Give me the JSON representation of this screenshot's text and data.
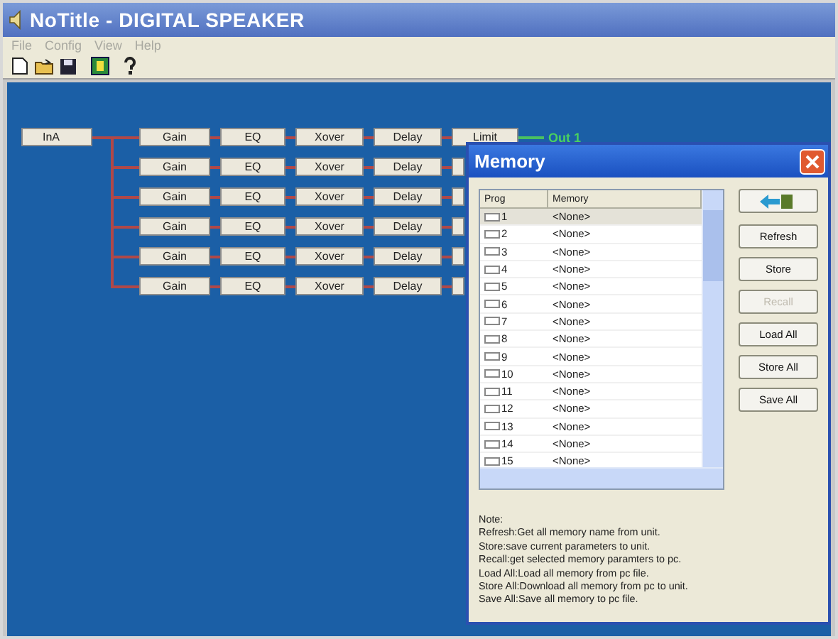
{
  "window": {
    "title": "NoTitle - DIGITAL SPEAKER"
  },
  "menu": [
    "File",
    "Config",
    "View",
    "Help"
  ],
  "chain": {
    "input": "InA",
    "rows": [
      {
        "blocks": [
          "Gain",
          "EQ",
          "Xover",
          "Delay",
          "Limit"
        ],
        "output": "Out 1"
      },
      {
        "blocks": [
          "Gain",
          "EQ",
          "Xover",
          "Delay"
        ]
      },
      {
        "blocks": [
          "Gain",
          "EQ",
          "Xover",
          "Delay"
        ]
      },
      {
        "blocks": [
          "Gain",
          "EQ",
          "Xover",
          "Delay"
        ]
      },
      {
        "blocks": [
          "Gain",
          "EQ",
          "Xover",
          "Delay"
        ]
      },
      {
        "blocks": [
          "Gain",
          "EQ",
          "Xover",
          "Delay"
        ]
      }
    ]
  },
  "dialog": {
    "title": "Memory",
    "columns": [
      "Prog",
      "Memory"
    ],
    "rows": [
      {
        "prog": "1",
        "memory": "<None>",
        "selected": true
      },
      {
        "prog": "2",
        "memory": "<None>",
        "selected": false
      },
      {
        "prog": "3",
        "memory": "<None>",
        "selected": false
      },
      {
        "prog": "4",
        "memory": "<None>",
        "selected": false
      },
      {
        "prog": "5",
        "memory": "<None>",
        "selected": false
      },
      {
        "prog": "6",
        "memory": "<None>",
        "selected": false
      },
      {
        "prog": "7",
        "memory": "<None>",
        "selected": false
      },
      {
        "prog": "8",
        "memory": "<None>",
        "selected": false
      },
      {
        "prog": "9",
        "memory": "<None>",
        "selected": false
      },
      {
        "prog": "10",
        "memory": "<None>",
        "selected": false
      },
      {
        "prog": "11",
        "memory": "<None>",
        "selected": false
      },
      {
        "prog": "12",
        "memory": "<None>",
        "selected": false
      },
      {
        "prog": "13",
        "memory": "<None>",
        "selected": false
      },
      {
        "prog": "14",
        "memory": "<None>",
        "selected": false
      },
      {
        "prog": "15",
        "memory": "<None>",
        "selected": false
      }
    ],
    "buttons": [
      {
        "kind": "icon",
        "disabled": false
      },
      {
        "kind": "text",
        "label": "Refresh",
        "disabled": false
      },
      {
        "kind": "text",
        "label": "Store",
        "disabled": false
      },
      {
        "kind": "text",
        "label": "Recall",
        "disabled": true
      },
      {
        "kind": "text",
        "label": "Load All",
        "disabled": false
      },
      {
        "kind": "text",
        "label": "Store All",
        "disabled": false
      },
      {
        "kind": "text",
        "label": "Save All",
        "disabled": false
      }
    ],
    "note": [
      "Note:",
      "Refresh:Get all memory name from unit.",
      "Store:save current parameters to unit.",
      "Recall:get selected memory paramters to pc.",
      "Load All:Load all memory from pc file.",
      "Store All:Download all memory from pc to unit.",
      "Save All:Save all memory to pc file."
    ]
  }
}
